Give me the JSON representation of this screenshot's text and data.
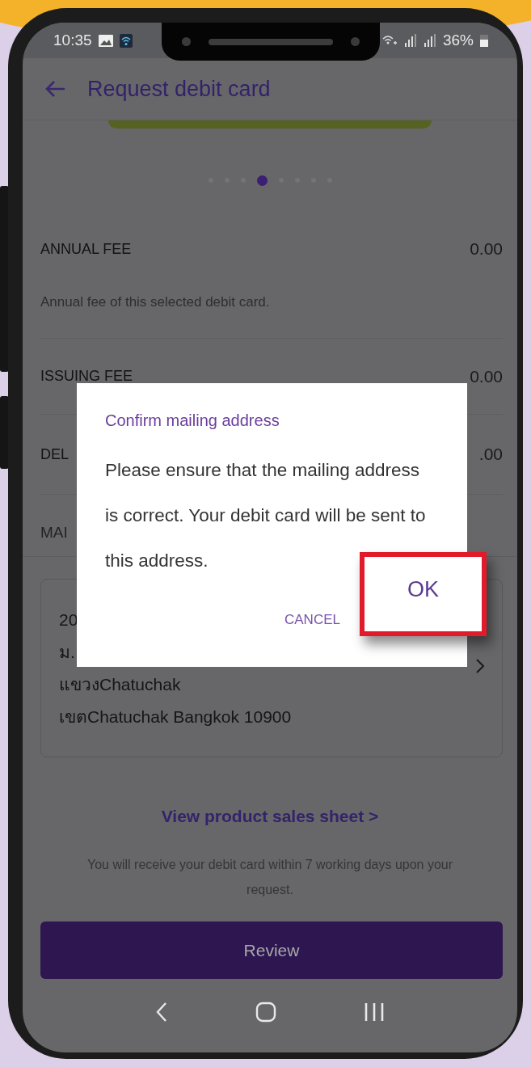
{
  "status_bar": {
    "time": "10:35",
    "battery": "36%"
  },
  "header": {
    "title": "Request debit card"
  },
  "carousel_dots": [
    {
      "selected": false
    },
    {
      "selected": false
    },
    {
      "selected": false
    },
    {
      "selected": true
    },
    {
      "selected": false
    },
    {
      "selected": false
    },
    {
      "selected": false
    },
    {
      "selected": false
    }
  ],
  "fees": [
    {
      "label": "ANNUAL FEE",
      "value": "0.00",
      "description": "Annual fee of this selected debit card."
    },
    {
      "label": "ISSUING FEE",
      "value": "0.00"
    },
    {
      "label": "DEL",
      "value": ".00"
    }
  ],
  "section_label": "MAI",
  "address_lines": [
    "20",
    "ม.",
    "แขวงChatuchak",
    "เขตChatuchak Bangkok 10900"
  ],
  "link": "View product sales sheet >",
  "note": "You will receive your debit card within 7 working days upon your request.",
  "review_button": "Review",
  "dialog": {
    "title": "Confirm mailing address",
    "message": "Please ensure that the mailing address is correct. Your debit card will be sent to this address.",
    "cancel": "CANCEL",
    "ok": "OK",
    "ok_highlighted": true
  }
}
